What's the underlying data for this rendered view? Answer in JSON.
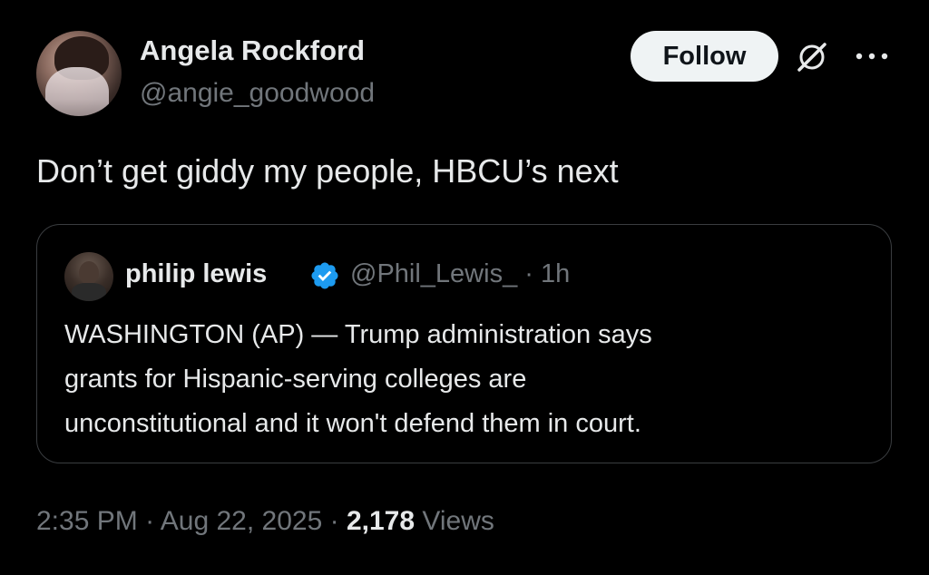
{
  "author": {
    "display_name": "Angela Rockford",
    "handle": "@angie_goodwood",
    "avatar_icon": "user-avatar"
  },
  "actions": {
    "follow_label": "Follow",
    "grok_icon": "grok-icon",
    "more_icon": "more-options-icon"
  },
  "tweet": {
    "text": "Don’t get giddy my people, HBCU’s next"
  },
  "quote": {
    "display_name": "philip lewis",
    "verified": true,
    "handle_time": "@Phil_Lewis_ · 1h",
    "body_lines": [
      "WASHINGTON (AP) — Trump administration says",
      "grants for Hispanic-serving colleges are",
      "unconstitutional and it won't defend them in court."
    ]
  },
  "meta": {
    "time": "2:35 PM",
    "date": "Aug 22, 2025",
    "views_count": "2,178",
    "views_label": "Views",
    "separator": "·"
  },
  "colors": {
    "background": "#000000",
    "primary_text": "#e7e9ea",
    "secondary_text": "#71767b",
    "verified_blue": "#1d9bf0",
    "border": "#3a3d40",
    "follow_bg": "#eff3f4"
  }
}
